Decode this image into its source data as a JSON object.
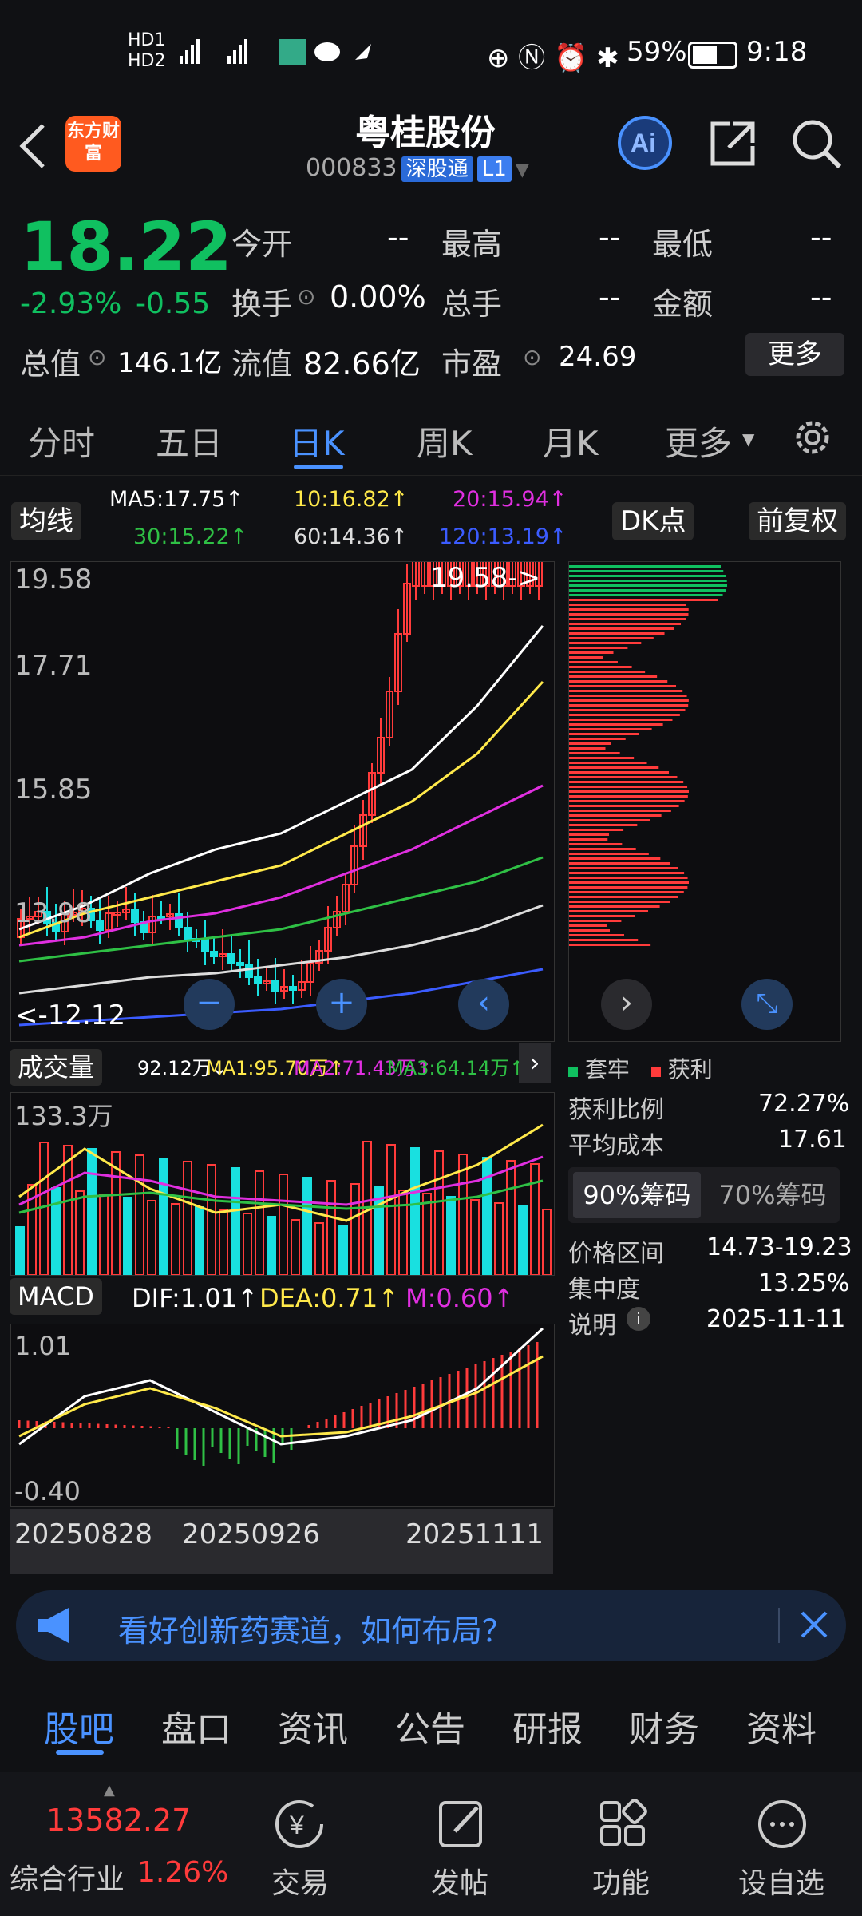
{
  "status_bar": {
    "battery": "59%",
    "time": "9:18"
  },
  "header": {
    "title": "粤桂股份",
    "code": "000833",
    "tag1": "深股通",
    "tag2": "L1",
    "logo_text": "东方财富"
  },
  "quote": {
    "price": "18.22",
    "change_pct": "-2.93%",
    "change": "-0.55",
    "rows": [
      [
        {
          "label": "今开",
          "value": "--"
        },
        {
          "label": "最高",
          "value": "--"
        },
        {
          "label": "最低",
          "value": "--"
        }
      ],
      [
        {
          "label": "换手",
          "value": "0.00%"
        },
        {
          "label": "总手",
          "value": "--"
        },
        {
          "label": "金额",
          "value": "--"
        }
      ],
      [
        {
          "label": "流值",
          "value": "82.66亿"
        },
        {
          "label": "市盈",
          "value": "24.69"
        }
      ]
    ],
    "total_value_label": "总值",
    "total_value": "146.1亿",
    "more": "更多"
  },
  "tabs": [
    "分时",
    "五日",
    "日K",
    "周K",
    "月K",
    "更多"
  ],
  "ma_legend": {
    "selector": "均线",
    "ma5": "MA5:17.75↑",
    "ma10": "10:16.82↑",
    "ma20": "20:15.94↑",
    "ma30": "30:15.22↑",
    "ma60": "60:14.36↑",
    "ma120": "120:13.19↑",
    "dk": "DK点",
    "fq": "前复权"
  },
  "kchart": {
    "y_top": "19.58",
    "y_mid": "17.71",
    "y_mid2": "15.85",
    "y_low": "13.98",
    "max_marker": "19.58->",
    "min_marker": "<-12.12"
  },
  "volume": {
    "selector": "成交量",
    "v": "92.12万↓",
    "ma1": "MA1:95.70万↑",
    "ma2": "MA2:71.43万↑",
    "ma3": "MA3:64.14万↑",
    "ymax": "133.3万"
  },
  "macd": {
    "selector": "MACD",
    "dif": "DIF:1.01↑",
    "dea": "DEA:0.71↑",
    "m": "M:0.60↑",
    "ymax": "1.01",
    "ymin": "-0.40"
  },
  "dates": [
    "20250828",
    "20250926",
    "20251111"
  ],
  "chips": {
    "legend_locked": "套牢",
    "legend_profit": "获利",
    "items": [
      {
        "label": "获利比例",
        "value": "72.27%"
      },
      {
        "label": "平均成本",
        "value": "17.61"
      }
    ],
    "btn90": "90%筹码",
    "btn70": "70%筹码",
    "items2": [
      {
        "label": "价格区间",
        "value": "14.73-19.23"
      },
      {
        "label": "集中度",
        "value": "13.25%"
      },
      {
        "label": "说明",
        "value": "2025-11-11"
      }
    ]
  },
  "banner": {
    "text": "看好创新药赛道，如何布局？"
  },
  "bottom_tabs": [
    "股吧",
    "盘口",
    "资讯",
    "公告",
    "研报",
    "财务",
    "资料"
  ],
  "footer": {
    "index_value": "13582.27",
    "index_name": "综合行业",
    "index_pct": "1.26%",
    "items": [
      "交易",
      "发帖",
      "功能",
      "设自选"
    ]
  },
  "colors": {
    "up": "#ff3b3b",
    "down": "#10c060",
    "accent": "#4a92ff",
    "bg": "#101114"
  }
}
